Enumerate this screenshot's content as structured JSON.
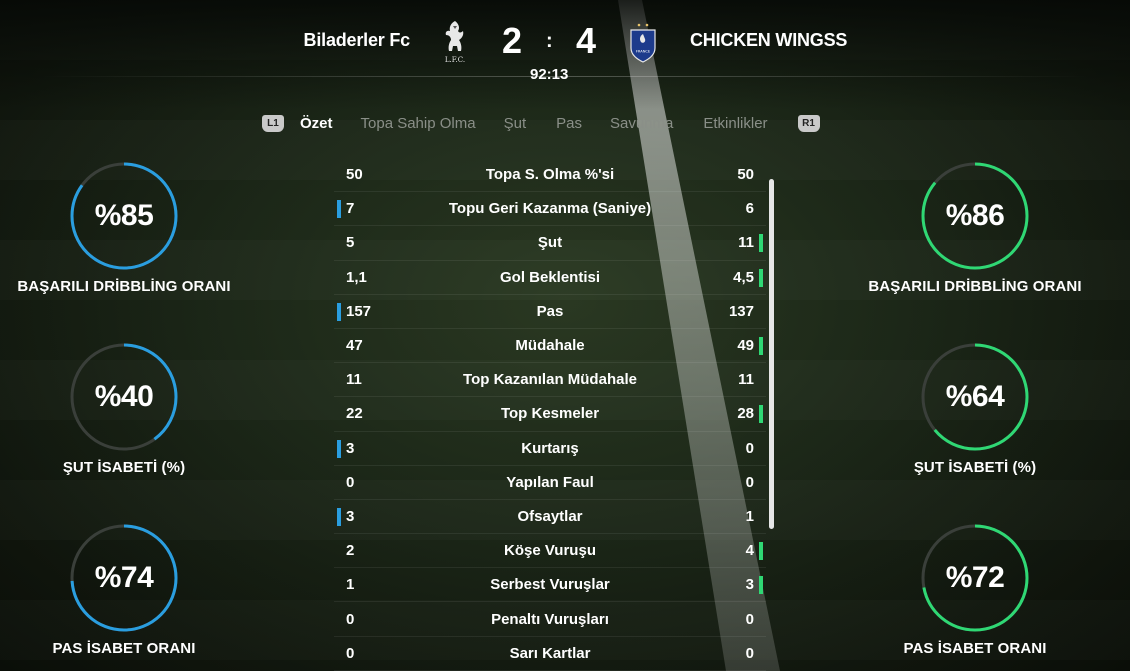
{
  "match": {
    "home_team": "Biladerler Fc",
    "away_team": "CHICKEN WINGSS",
    "home_score": "2",
    "away_score": "4",
    "separator": ":",
    "clock": "92:13",
    "home_crest_text": "L.F.C.",
    "away_crest_text": "FRANCE"
  },
  "tabs": {
    "left_shoulder": "L1",
    "right_shoulder": "R1",
    "items": [
      "Özet",
      "Topa Sahip Olma",
      "Şut",
      "Pas",
      "Savunma",
      "Etkinlikler"
    ],
    "active": "Özet"
  },
  "stats": [
    {
      "label": "Topa S. Olma %'si",
      "home": "50",
      "away": "50",
      "lead": "none"
    },
    {
      "label": "Topu Geri Kazanma (Saniye)",
      "home": "7",
      "away": "6",
      "lead": "home"
    },
    {
      "label": "Şut",
      "home": "5",
      "away": "11",
      "lead": "away"
    },
    {
      "label": "Gol Beklentisi",
      "home": "1,1",
      "away": "4,5",
      "lead": "away"
    },
    {
      "label": "Pas",
      "home": "157",
      "away": "137",
      "lead": "home"
    },
    {
      "label": "Müdahale",
      "home": "47",
      "away": "49",
      "lead": "away"
    },
    {
      "label": "Top Kazanılan Müdahale",
      "home": "11",
      "away": "11",
      "lead": "none"
    },
    {
      "label": "Top Kesmeler",
      "home": "22",
      "away": "28",
      "lead": "away"
    },
    {
      "label": "Kurtarış",
      "home": "3",
      "away": "0",
      "lead": "home"
    },
    {
      "label": "Yapılan Faul",
      "home": "0",
      "away": "0",
      "lead": "none"
    },
    {
      "label": "Ofsaytlar",
      "home": "3",
      "away": "1",
      "lead": "home"
    },
    {
      "label": "Köşe Vuruşu",
      "home": "2",
      "away": "4",
      "lead": "away"
    },
    {
      "label": "Serbest Vuruşlar",
      "home": "1",
      "away": "3",
      "lead": "away"
    },
    {
      "label": "Penaltı Vuruşları",
      "home": "0",
      "away": "0",
      "lead": "none"
    },
    {
      "label": "Sarı Kartlar",
      "home": "0",
      "away": "0",
      "lead": "none"
    }
  ],
  "gauges": {
    "home": [
      {
        "value": "%85",
        "percent": 85,
        "label": "BAŞARILI DRİBBLİNG ORANI"
      },
      {
        "value": "%40",
        "percent": 40,
        "label": "ŞUT İSABETİ (%)"
      },
      {
        "value": "%74",
        "percent": 74,
        "label": "PAS İSABET ORANI"
      }
    ],
    "away": [
      {
        "value": "%86",
        "percent": 86,
        "label": "BAŞARILI DRİBBLİNG ORANI"
      },
      {
        "value": "%64",
        "percent": 64,
        "label": "ŞUT İSABETİ (%)"
      },
      {
        "value": "%72",
        "percent": 72,
        "label": "PAS İSABET ORANI"
      }
    ]
  },
  "colors": {
    "home_accent": "#2a9ee0",
    "away_accent": "#2fd874",
    "track": "#3a3f3a",
    "inactive_tab": "#8a8f88"
  }
}
